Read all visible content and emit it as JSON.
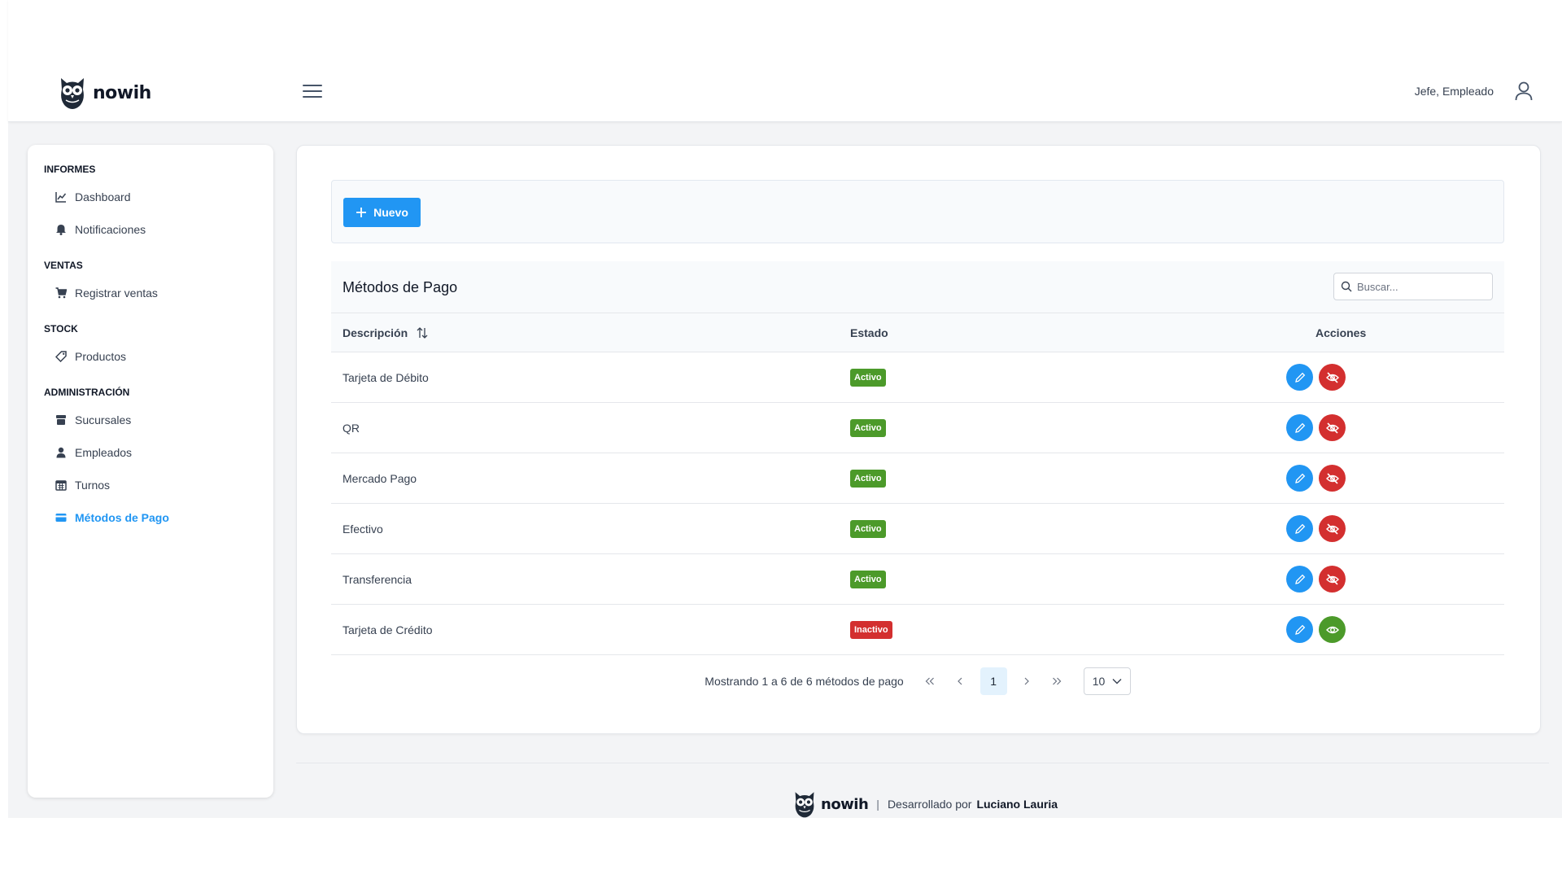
{
  "header": {
    "brand": "nowih",
    "user_name": "Jefe, Empleado"
  },
  "sidebar": {
    "sections": [
      {
        "title": "INFORMES",
        "items": [
          {
            "label": "Dashboard",
            "icon": "chart-line-icon"
          },
          {
            "label": "Notificaciones",
            "icon": "bell-icon"
          }
        ]
      },
      {
        "title": "VENTAS",
        "items": [
          {
            "label": "Registrar ventas",
            "icon": "cart-icon"
          }
        ]
      },
      {
        "title": "STOCK",
        "items": [
          {
            "label": "Productos",
            "icon": "tag-icon"
          }
        ]
      },
      {
        "title": "ADMINISTRACIÓN",
        "items": [
          {
            "label": "Sucursales",
            "icon": "store-icon"
          },
          {
            "label": "Empleados",
            "icon": "user-icon"
          },
          {
            "label": "Turnos",
            "icon": "calendar-icon"
          },
          {
            "label": "Métodos de Pago",
            "icon": "credit-card-icon",
            "active": true
          }
        ]
      }
    ]
  },
  "toolbar": {
    "new_label": "Nuevo"
  },
  "table": {
    "title": "Métodos de Pago",
    "search_placeholder": "Buscar...",
    "columns": {
      "description": "Descripción",
      "status": "Estado",
      "actions": "Acciones"
    },
    "rows": [
      {
        "description": "Tarjeta de Débito",
        "status": "Activo",
        "active": true
      },
      {
        "description": "QR",
        "status": "Activo",
        "active": true
      },
      {
        "description": "Mercado Pago",
        "status": "Activo",
        "active": true
      },
      {
        "description": "Efectivo",
        "status": "Activo",
        "active": true
      },
      {
        "description": "Transferencia",
        "status": "Activo",
        "active": true
      },
      {
        "description": "Tarjeta de Crédito",
        "status": "Inactivo",
        "active": false
      }
    ]
  },
  "pagination": {
    "info": "Mostrando 1 a 6 de 6 métodos de pago",
    "current_page": "1",
    "page_size": "10"
  },
  "footer": {
    "brand": "nowih",
    "developed_by": "Desarrollado por",
    "author": "Luciano Lauria"
  },
  "colors": {
    "primary": "#2196f3",
    "success": "#4c9a2a",
    "danger": "#d32f2f"
  }
}
